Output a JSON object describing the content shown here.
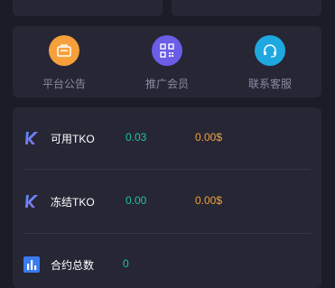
{
  "quick_actions": [
    {
      "label": "平台公告",
      "icon": "announcement-icon",
      "color": "#f5a03a"
    },
    {
      "label": "推广会员",
      "icon": "qr-code-icon",
      "color": "#6b5de6"
    },
    {
      "label": "联系客服",
      "icon": "headset-icon",
      "color": "#1fa8e0"
    }
  ],
  "assets": {
    "rows": [
      {
        "icon": "tko-logo-icon",
        "label": "可用TKO",
        "amount": "0.03",
        "usd": "0.00$"
      },
      {
        "icon": "tko-logo-icon",
        "label": "冻结TKO",
        "amount": "0.00",
        "usd": "0.00$"
      },
      {
        "icon": "bar-chart-icon",
        "label": "合约总数",
        "amount": "0"
      }
    ]
  },
  "colors": {
    "background": "#1c1c28",
    "card": "#262635",
    "amount_green": "#1fc49a",
    "usd_orange": "#f0a23c",
    "label_gray": "#8a8ba0"
  }
}
